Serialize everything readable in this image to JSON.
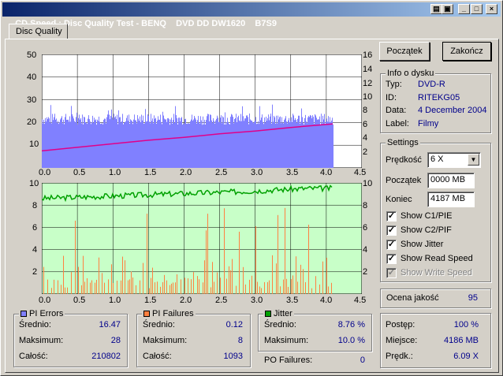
{
  "window": {
    "title": "CD Speed : Disc Quality Test - BENQ    DVD DD DW1620    B7S9"
  },
  "tabs": [
    {
      "label": "Disc Quality"
    }
  ],
  "buttons": {
    "start": "Początek",
    "end": "Zakończ"
  },
  "disc_info": {
    "title": "Info o dysku",
    "rows": [
      {
        "label": "Typ:",
        "value": "DVD-R"
      },
      {
        "label": "ID:",
        "value": "RITEKG05"
      },
      {
        "label": "Data:",
        "value": "4 December 2004"
      },
      {
        "label": "Label:",
        "value": "Filmy"
      }
    ]
  },
  "settings": {
    "title": "Settings",
    "speed_label": "Prędkość",
    "speed_value": "6 X",
    "start_label": "Początek",
    "start_value": "0000 MB",
    "end_label": "Koniec",
    "end_value": "4187 MB",
    "checks": [
      {
        "label": "Show C1/PIE",
        "checked": true,
        "disabled": false
      },
      {
        "label": "Show C2/PIF",
        "checked": true,
        "disabled": false
      },
      {
        "label": "Show Jitter",
        "checked": true,
        "disabled": false
      },
      {
        "label": "Show Read Speed",
        "checked": true,
        "disabled": false
      },
      {
        "label": "Show Write Speed",
        "checked": true,
        "disabled": true
      }
    ]
  },
  "quality": {
    "label": "Ocena jakość",
    "value": "95"
  },
  "progress": {
    "rows": [
      {
        "label": "Postęp:",
        "value": "100 %"
      },
      {
        "label": "Miejsce:",
        "value": "4186 MB"
      },
      {
        "label": "Prędk.:",
        "value": "6.09 X"
      }
    ]
  },
  "pi_errors": {
    "title": "PI Errors",
    "color": "#8080ff",
    "rows": [
      {
        "label": "Średnio:",
        "value": "16.47"
      },
      {
        "label": "Maksimum:",
        "value": "28"
      },
      {
        "label": "Całość:",
        "value": "210802"
      }
    ]
  },
  "pi_failures": {
    "title": "PI Failures",
    "color": "#ff8040",
    "rows": [
      {
        "label": "Średnio:",
        "value": "0.12"
      },
      {
        "label": "Maksimum:",
        "value": "8"
      },
      {
        "label": "Całość:",
        "value": "1093"
      }
    ]
  },
  "jitter": {
    "title": "Jitter",
    "color": "#00a000",
    "rows": [
      {
        "label": "Średnio:",
        "value": "8.76 %"
      },
      {
        "label": "Maksimum:",
        "value": "10.0 %"
      }
    ]
  },
  "po_failures": {
    "label": "PO Failures:",
    "value": "0"
  },
  "chart_data": [
    {
      "type": "area",
      "x_ticks": [
        "0.0",
        "0.5",
        "1.0",
        "1.5",
        "2.0",
        "2.5",
        "3.0",
        "3.5",
        "4.0",
        "4.5"
      ],
      "y_left_ticks": [
        "10",
        "20",
        "30",
        "40",
        "50"
      ],
      "y_right_ticks": [
        "2",
        "4",
        "6",
        "8",
        "10",
        "12",
        "14",
        "16"
      ],
      "xlim": [
        0,
        4.5
      ],
      "ylim": [
        0,
        50
      ],
      "y2lim": [
        0,
        16
      ],
      "grid": true,
      "series": [
        {
          "values_x": [
            0.0,
            4.09
          ],
          "values_range": [
            19,
            24
          ],
          "color": "#8080ff"
        },
        {
          "values_x": [
            0.0,
            0.5,
            1.0,
            1.5,
            2.0,
            2.5,
            3.0,
            3.5,
            4.09
          ],
          "values": [
            2.4,
            2.9,
            3.4,
            3.9,
            4.3,
            4.8,
            5.2,
            5.7,
            6.2
          ],
          "color": "#e0008a"
        }
      ]
    },
    {
      "type": "bar",
      "x_ticks": [
        "0.0",
        "0.5",
        "1.0",
        "1.5",
        "2.0",
        "2.5",
        "3.0",
        "3.5",
        "4.0",
        "4.5"
      ],
      "y_left_ticks": [
        "2",
        "4",
        "6",
        "8",
        "10"
      ],
      "y_right_ticks": [
        "2",
        "4",
        "6",
        "8",
        "10"
      ],
      "xlim": [
        0,
        4.5
      ],
      "ylim": [
        0,
        10
      ],
      "grid": true,
      "series": [
        {
          "values_x": [
            0.0,
            4.09
          ],
          "values_max": 8,
          "color": "#ff8040"
        },
        {
          "values_x": [
            0.0,
            1.0,
            2.0,
            3.0,
            4.09
          ],
          "values": [
            8.6,
            8.8,
            9.0,
            9.2,
            9.5
          ],
          "color": "#00a000"
        }
      ]
    }
  ]
}
